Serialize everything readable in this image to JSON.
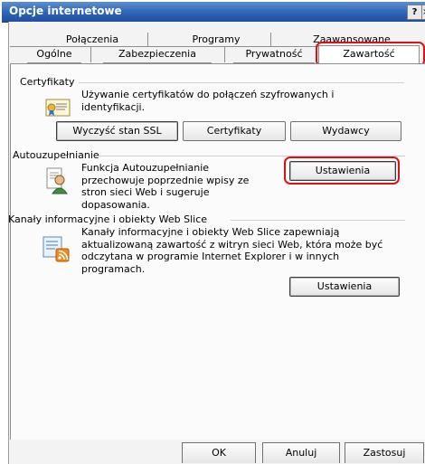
{
  "window": {
    "title": "Opcje internetowe",
    "help_label": "?",
    "close_label": "×"
  },
  "tabs": {
    "row1": [
      "Połączenia",
      "Programy",
      "Zaawansowane"
    ],
    "row2": [
      "Ogólne",
      "Zabezpieczenia",
      "Prywatność",
      "Zawartość"
    ],
    "active": "Zawartość"
  },
  "certificates": {
    "title": "Certyfikaty",
    "description": "Używanie certyfikatów do połączeń szyfrowanych i identyfikacji.",
    "buttons": {
      "clear_ssl": "Wyczyść stan SSL",
      "certificates": "Certyfikaty",
      "publishers": "Wydawcy"
    }
  },
  "autocomplete": {
    "title": "Autouzupełnianie",
    "description": "Funkcja Autouzupełnianie przechowuje poprzednie wpisy ze stron sieci Web i sugeruje dopasowania.",
    "settings_label": "Ustawienia"
  },
  "feeds": {
    "title": "Kanały informacyjne i obiekty Web Slice",
    "description": "Kanały informacyjne i obiekty Web Slice zapewniają aktualizowaną zawartość z witryn sieci Web, która może być odczytana w programie Internet Explorer i w innych programach.",
    "settings_label": "Ustawienia"
  },
  "footer": {
    "ok": "OK",
    "cancel": "Anuluj",
    "apply": "Zastosuj"
  },
  "colors": {
    "highlight": "#e01010",
    "titlebar": "#2f63b5"
  },
  "icons": {
    "certificate": "certificate-icon",
    "autocomplete": "autocomplete-icon",
    "feeds": "feeds-icon"
  }
}
